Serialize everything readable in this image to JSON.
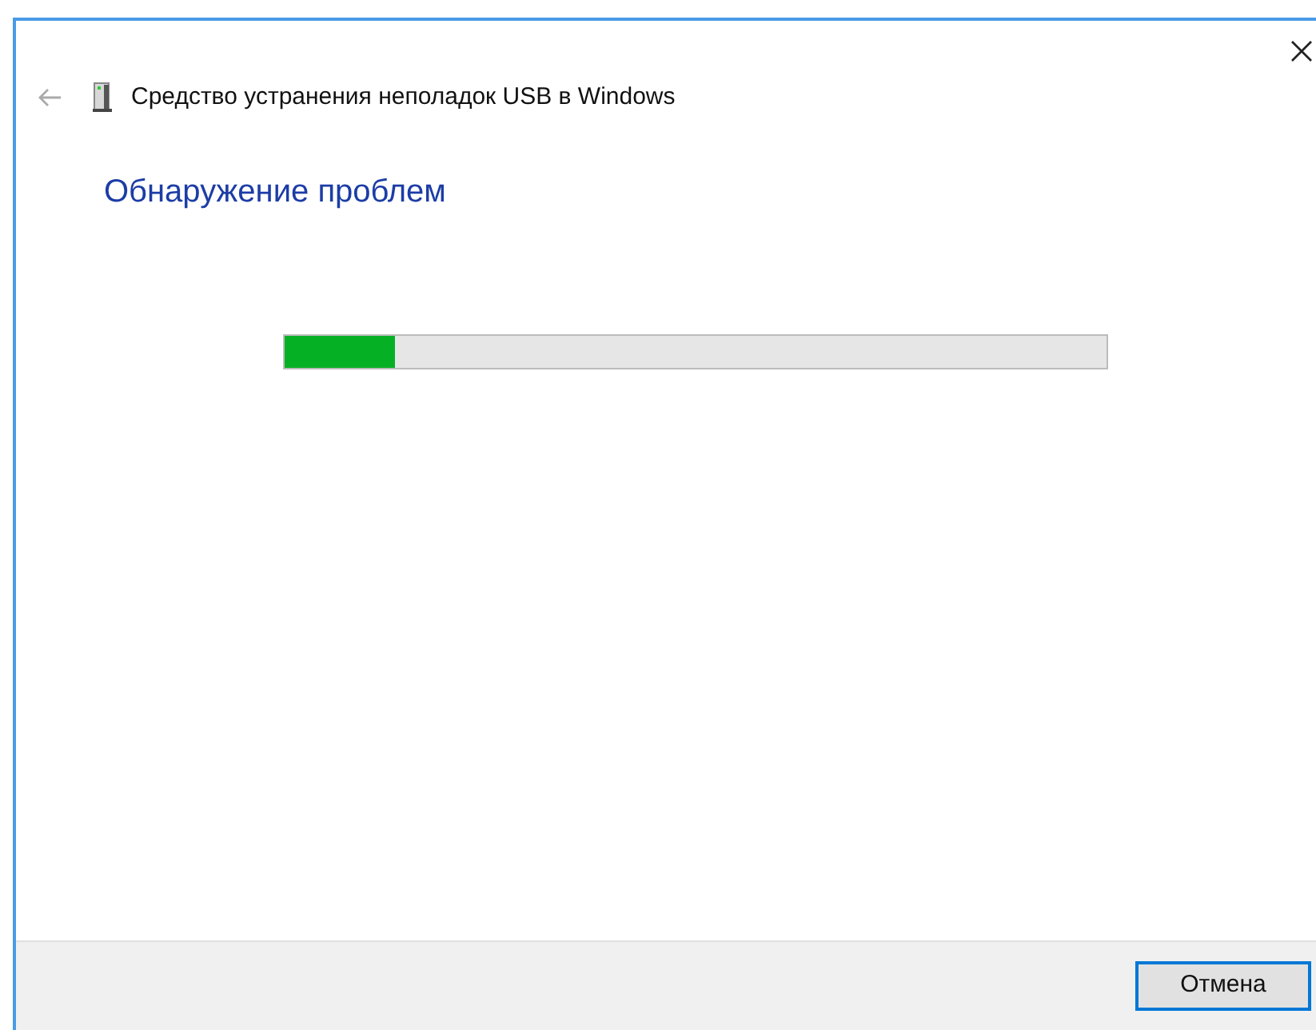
{
  "window": {
    "title": "Средство устранения неполадок USB в Windows"
  },
  "heading": "Обнаружение проблем",
  "progress": {
    "level": 0.135
  },
  "buttons": [
    {
      "label": "Отмена",
      "selected": true
    }
  ]
}
